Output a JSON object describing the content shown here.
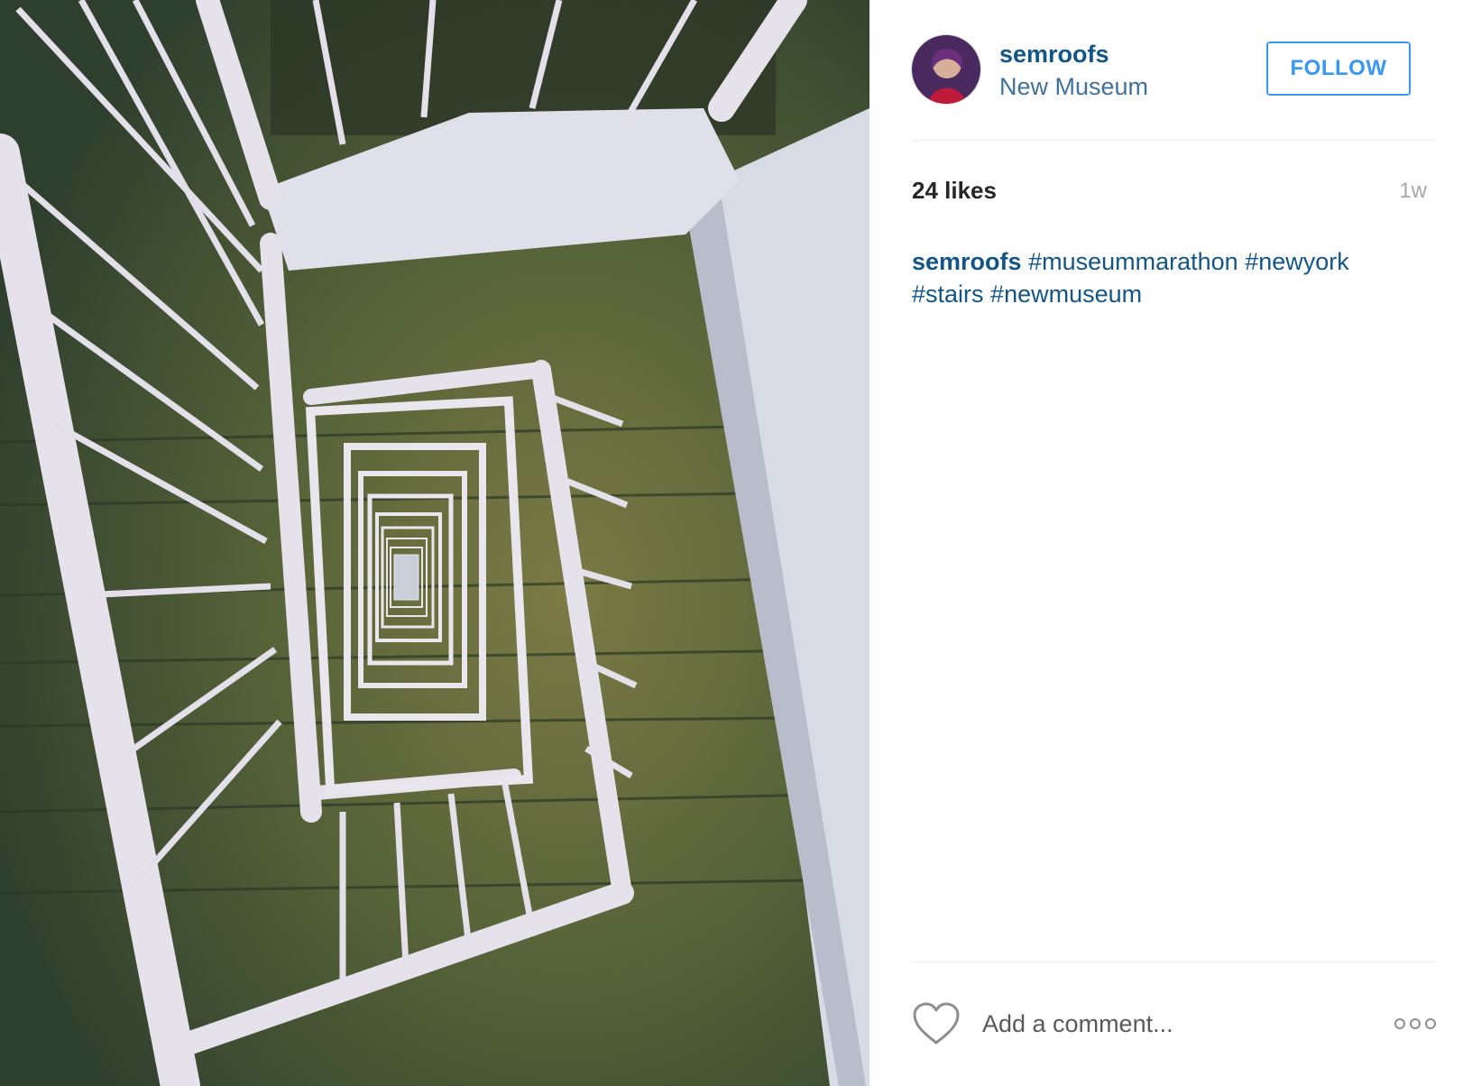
{
  "post": {
    "username": "semroofs",
    "location": "New Museum",
    "follow_label": "FOLLOW",
    "likes": "24 likes",
    "time": "1w",
    "caption": {
      "user": "semroofs",
      "tags": [
        "#museummarathon",
        "#newyork",
        "#stairs",
        "#newmuseum"
      ]
    },
    "comment_placeholder": "Add a comment...",
    "icons": {
      "like": "heart-outline-icon",
      "more": "more-options-icon"
    }
  },
  "colors": {
    "link": "#125688",
    "location": "#3f729b",
    "follow": "#3897f0"
  }
}
